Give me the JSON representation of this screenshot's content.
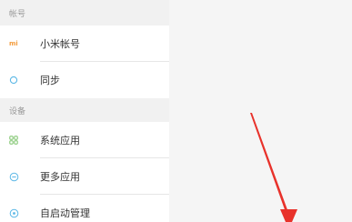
{
  "sections": [
    {
      "header": "帐号",
      "items": [
        {
          "icon": "mi-logo-icon",
          "label": "小米帐号",
          "accent": "#f39c3d"
        },
        {
          "icon": "sync-icon",
          "label": "同步",
          "accent": "#5cb8e6"
        }
      ]
    },
    {
      "header": "设备",
      "items": [
        {
          "icon": "grid-apps-icon",
          "label": "系统应用",
          "accent": "#7cc36b"
        },
        {
          "icon": "more-apps-icon",
          "label": "更多应用",
          "accent": "#5cb8e6"
        },
        {
          "icon": "autostart-icon",
          "label": "自启动管理",
          "accent": "#5cb8e6"
        }
      ]
    }
  ],
  "mi_logo_text": "mi",
  "annotation_color": "#e8322b"
}
